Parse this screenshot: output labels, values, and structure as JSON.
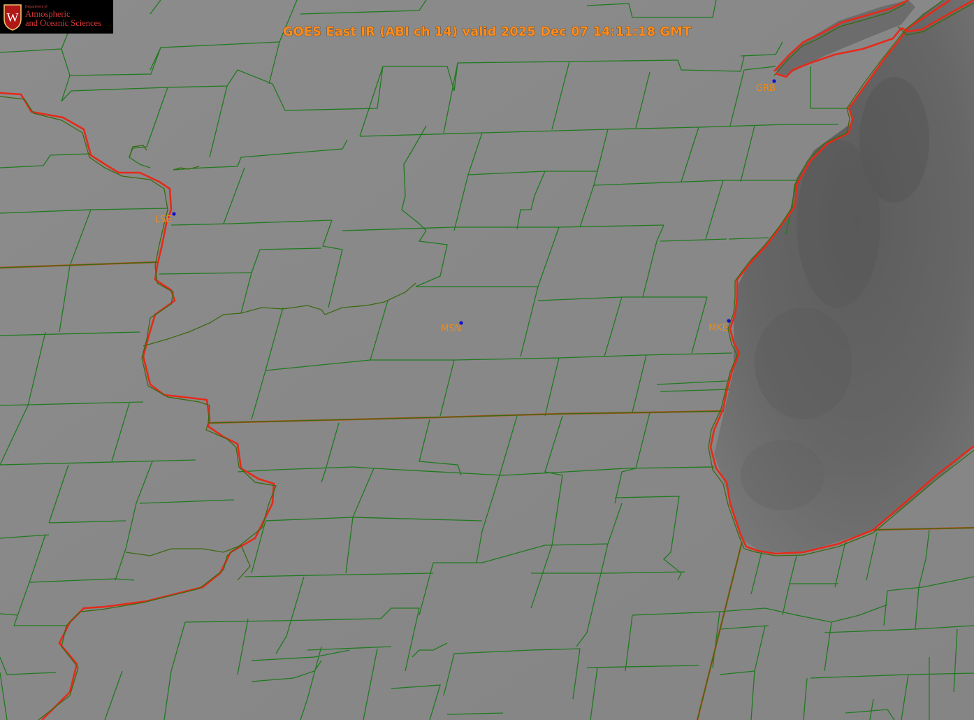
{
  "title": "GOES East IR (ABI ch 14) valid 2025 Dec 07 14:11:18 GMT",
  "logo": {
    "crest_letter": "W",
    "department_small": "Department of",
    "line1": "Atmospheric",
    "line2": "and Oceanic Sciences"
  },
  "stations": [
    {
      "id": "LSE",
      "label": "LSE"
    },
    {
      "id": "MSN",
      "label": "MSN"
    },
    {
      "id": "MKE",
      "label": "MKE"
    },
    {
      "id": "GRB",
      "label": "GRB"
    }
  ],
  "colors": {
    "background_land": "#8a8a8a",
    "lake_dark": "#606060",
    "county_lines": "#1f7a1f",
    "state_lines": "#b84a1a",
    "coastline": "#e52a1a",
    "station_dot": "#1010d0",
    "label_text": "#f08a10",
    "title_text": "#ff8c1a"
  }
}
